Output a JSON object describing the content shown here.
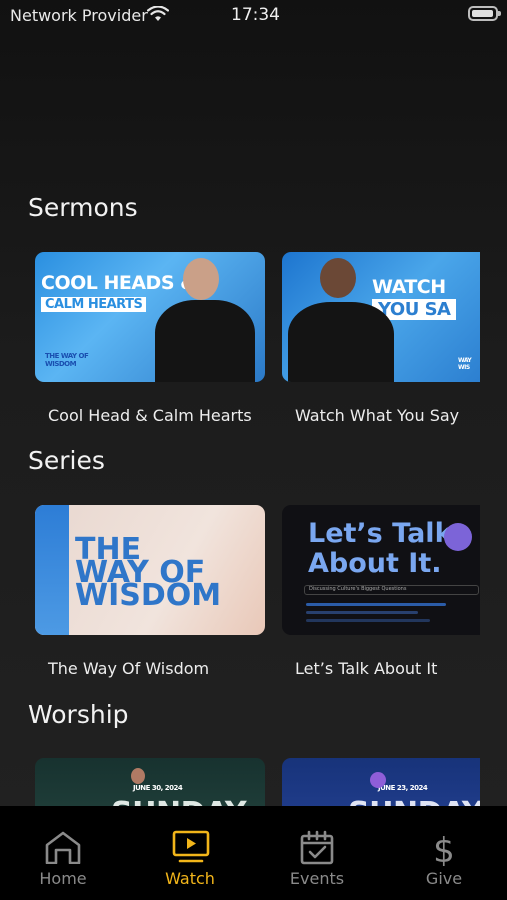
{
  "status_bar": {
    "carrier": "Network Provider",
    "time": "17:34"
  },
  "sections": [
    {
      "title": "Sermons",
      "items": [
        {
          "label": "Cool Head & Calm Hearts",
          "thumb_line1": "COOL HEADS &",
          "thumb_line2": "CALM HEARTS",
          "thumb_badge": "THE WAY OF WISDOM"
        },
        {
          "label": "Watch What You Say",
          "thumb_line1": "WATCH WH",
          "thumb_line2": "YOU SA",
          "thumb_badge": "WAY WIS"
        }
      ]
    },
    {
      "title": "Series",
      "items": [
        {
          "label": "The Way Of Wisdom",
          "thumb_line1": "THE",
          "thumb_line2": "WAY OF",
          "thumb_line3": "WISDOM"
        },
        {
          "label": "Let’s Talk About It",
          "thumb_line1": "Let’s Talk",
          "thumb_line2": "About It.",
          "thumb_sub": "Discussing Culture's Biggest Questions"
        }
      ]
    },
    {
      "title": "Worship",
      "items": [
        {
          "thumb_date": "JUNE 30, 2024",
          "thumb_word": "SUNDAY"
        },
        {
          "thumb_date": "JUNE 23, 2024",
          "thumb_word": "SUNDAY"
        }
      ]
    }
  ],
  "tabbar": {
    "active": "Watch",
    "tabs": [
      {
        "label": "Home",
        "icon": "home-icon"
      },
      {
        "label": "Watch",
        "icon": "play-screen-icon"
      },
      {
        "label": "Events",
        "icon": "calendar-check-icon"
      },
      {
        "label": "Give",
        "icon": "dollar-icon"
      }
    ]
  },
  "colors": {
    "accent": "#f2b51a",
    "inactive_tab": "#8a8a8a",
    "background": "#1a1a1a"
  }
}
